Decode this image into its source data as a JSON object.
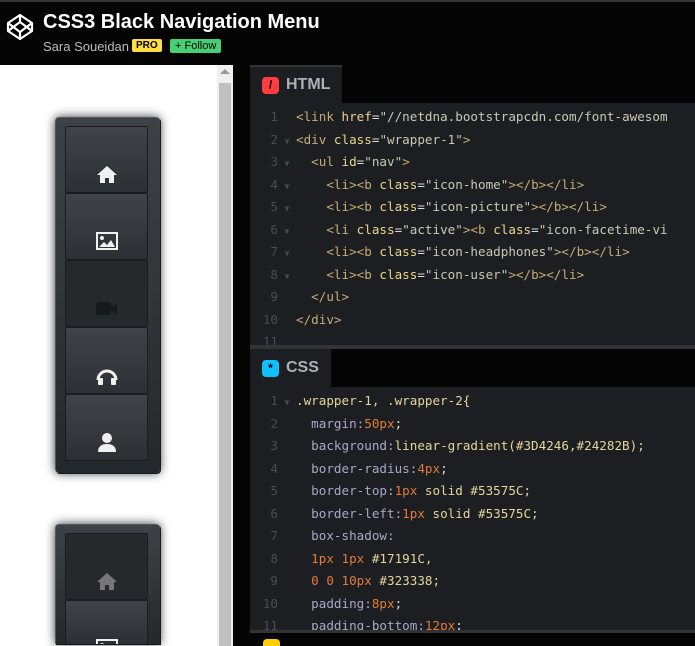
{
  "header": {
    "title": "CSS3 Black Navigation Menu",
    "author": "Sara Soueidan",
    "pro_badge": "PRO",
    "follow_label": "+ Follow"
  },
  "preview": {
    "nav_items": [
      "home-icon",
      "picture-icon",
      "facetime-video-icon",
      "headphones-icon",
      "user-icon"
    ],
    "active_index": 2
  },
  "html_panel": {
    "tab_label": "HTML",
    "icon_color": "#ff3c41",
    "lines": [
      [
        "1",
        "<link ",
        "href",
        "=",
        "\"//netdna.bootstrapcdn.com/font-awesom"
      ],
      [
        "2",
        "<div ",
        "class",
        "=",
        "\"wrapper-1\"",
        ">"
      ],
      [
        "3",
        "  <ul ",
        "id",
        "=",
        "\"nav\"",
        ">"
      ],
      [
        "4",
        "    <li><b ",
        "class",
        "=",
        "\"icon-home\"",
        "></b></li>"
      ],
      [
        "5",
        "    <li><b ",
        "class",
        "=",
        "\"icon-picture\"",
        "></b></li>"
      ],
      [
        "6",
        "    <li ",
        "class",
        "=",
        "\"active\"",
        "><b ",
        "class",
        "=",
        "\"icon-facetime-vi"
      ],
      [
        "7",
        "    <li><b ",
        "class",
        "=",
        "\"icon-headphones\"",
        "></b></li>"
      ],
      [
        "8",
        "    <li><b ",
        "class",
        "=",
        "\"icon-user\"",
        "></b></li>"
      ],
      [
        "9",
        "  </ul>"
      ],
      [
        "10",
        "</div>"
      ],
      [
        "11",
        ""
      ]
    ]
  },
  "css_panel": {
    "tab_label": "CSS",
    "icon_color": "#0ebeff",
    "lines": [
      [
        "1",
        "v",
        ".wrapper-1, .wrapper-2{"
      ],
      [
        "2",
        "p",
        "  margin:",
        "n",
        "50px",
        "w",
        ";"
      ],
      [
        "3",
        "p",
        "  background:",
        "v",
        "linear-gradient(#3D4246,#24282B);"
      ],
      [
        "4",
        "p",
        "  border-radius:",
        "n",
        "4px",
        "w",
        ";"
      ],
      [
        "5",
        "p",
        "  border-top:",
        "n",
        "1px",
        "v",
        " solid #53575C;"
      ],
      [
        "6",
        "p",
        "  border-left:",
        "n",
        "1px",
        "v",
        " solid #53575C;"
      ],
      [
        "7",
        "p",
        "  box-shadow:"
      ],
      [
        "8",
        "n",
        "  1px 1px ",
        "v",
        "#17191C,"
      ],
      [
        "9",
        "n",
        "  0 0 10px ",
        "v",
        "#323338;"
      ],
      [
        "10",
        "p",
        "  padding:",
        "n",
        "8px",
        "w",
        ";"
      ],
      [
        "11",
        "p",
        "  padding-bottom:",
        "n",
        "12px",
        "w",
        ";"
      ]
    ]
  },
  "js_panel": {
    "icon_color": "#fcd000"
  }
}
